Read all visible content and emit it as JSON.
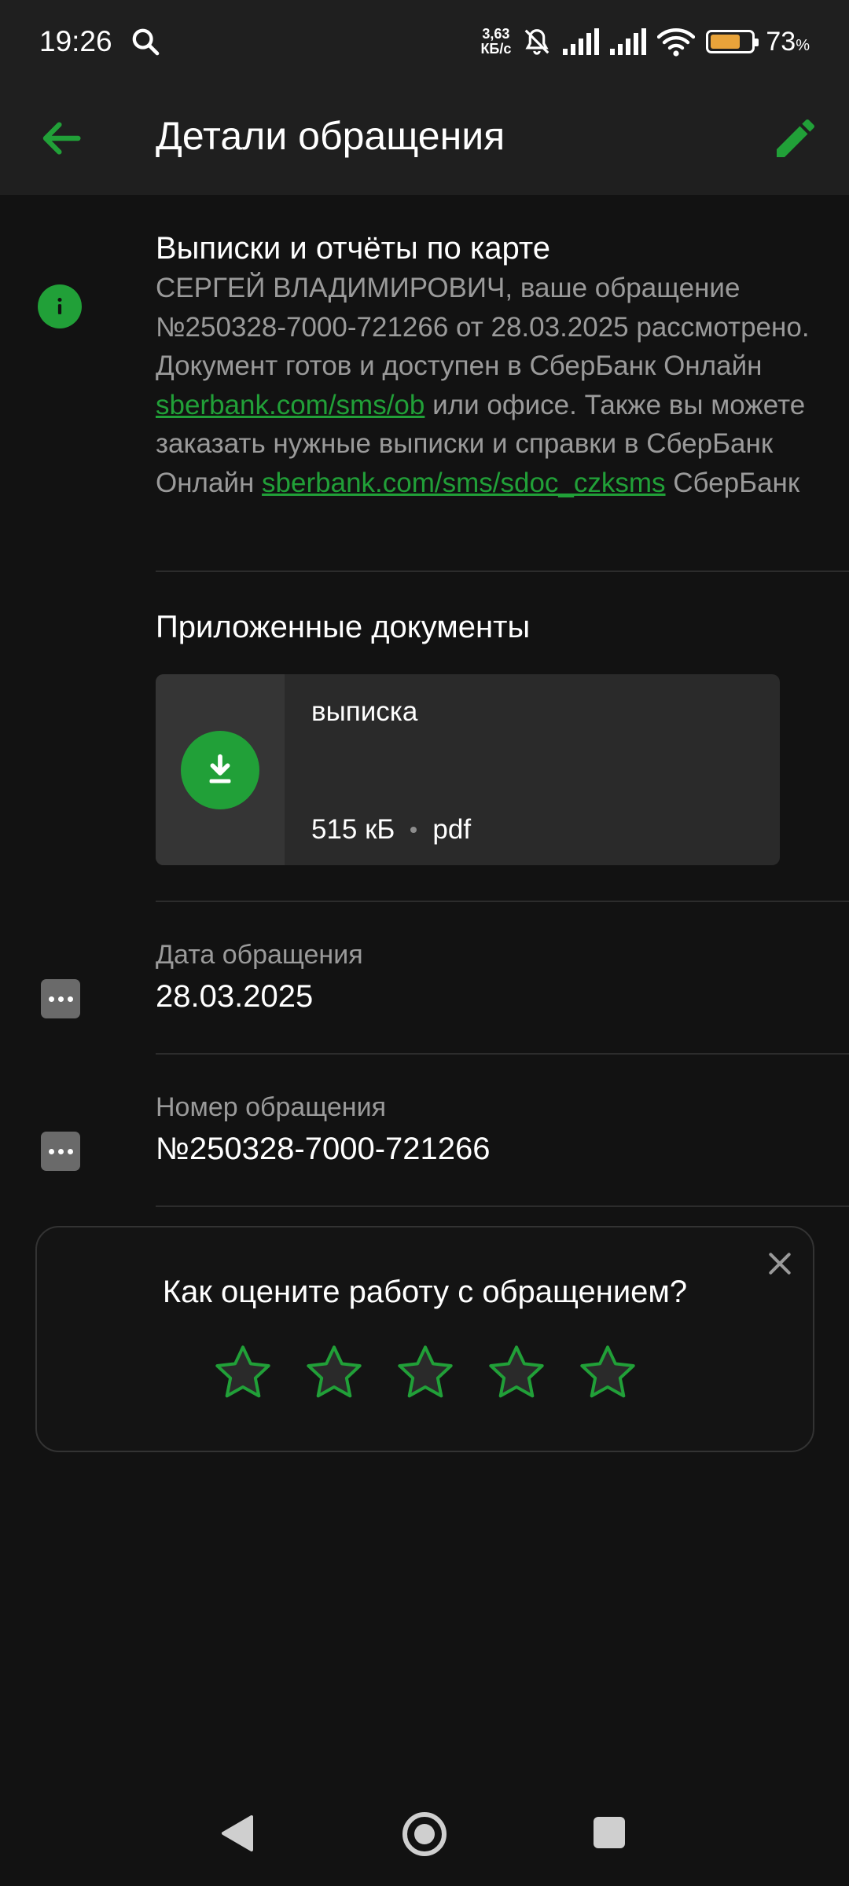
{
  "status_bar": {
    "time": "19:26",
    "net_speed_value": "3,63",
    "net_speed_unit": "КБ/с",
    "battery_percent": "73",
    "battery_percent_sign": "%",
    "battery_level": 0.73,
    "icons": [
      "search-icon",
      "bell-off-icon",
      "signal-icon",
      "signal-icon",
      "wifi-icon",
      "battery-icon"
    ]
  },
  "app_bar": {
    "title": "Детали обращения",
    "back_icon": "arrow-left-icon",
    "edit_icon": "pencil-icon"
  },
  "message": {
    "title": "Выписки и отчёты по карте",
    "body_part1": "СЕРГЕЙ ВЛАДИМИРОВИЧ, ваше обращение №250328-7000-721266 от 28.03.2025 рассмотрено. Документ готов и доступен в СберБанк Онлайн ",
    "link1": "sberbank.com/sms/ob",
    "body_part2": " или офисе. Также вы можете заказать нужные выписки и справки в СберБанк Онлайн ",
    "link2": "sberbank.com/sms/sdoc_czksms",
    "body_part3": " СберБанк"
  },
  "attachments": {
    "title": "Приложенные документы",
    "items": [
      {
        "name": "выписка",
        "size": "515 кБ",
        "type": "pdf"
      }
    ]
  },
  "fields": [
    {
      "label": "Дата обращения",
      "value": "28.03.2025"
    },
    {
      "label": "Номер обращения",
      "value": "№250328-7000-721266"
    }
  ],
  "rating": {
    "question": "Как оцените работу с обращением?",
    "max_stars": 5,
    "selected": 0
  },
  "colors": {
    "accent": "#21a038",
    "background": "#121212",
    "surface": "#1f1f1f",
    "secondary_text": "#9a9a9a"
  }
}
